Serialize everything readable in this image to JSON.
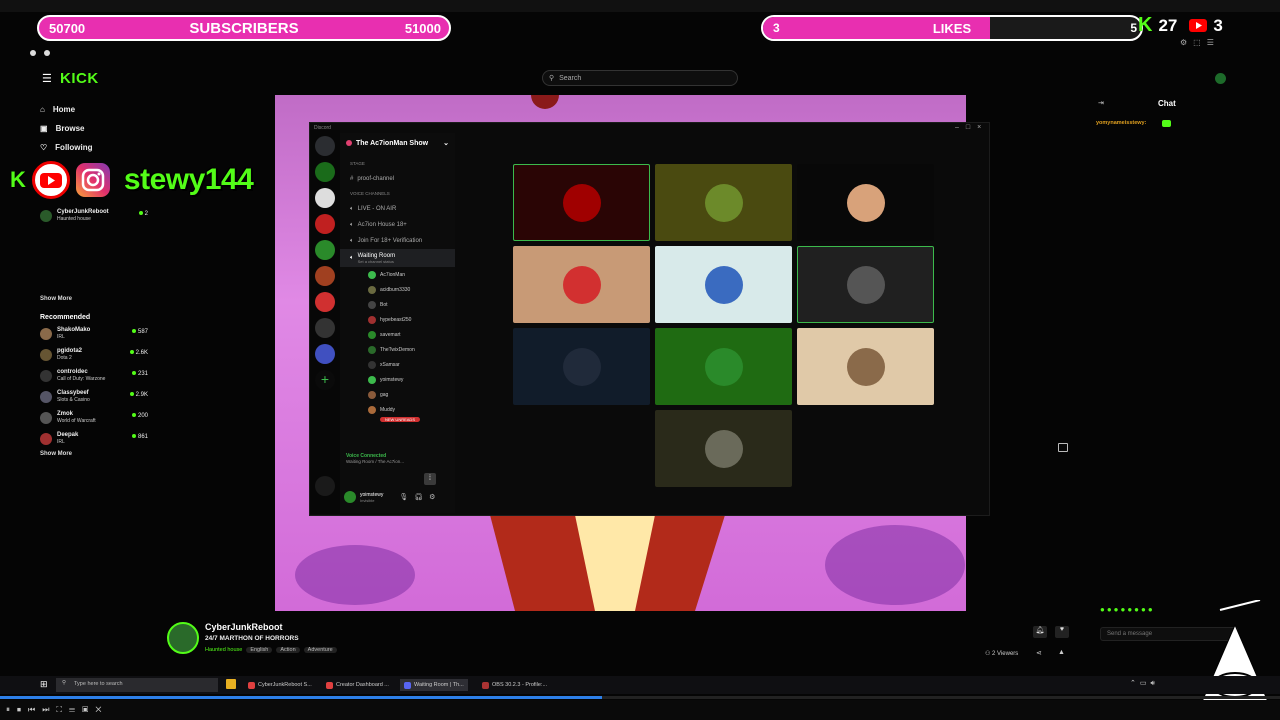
{
  "overlay": {
    "subs_current": "50700",
    "subs_label": "SUBSCRIBERS",
    "subs_goal": "51000",
    "subs_progress": 0.0,
    "likes_current": "3",
    "likes_label": "LIKES",
    "likes_goal": "5",
    "likes_progress": 0.6,
    "kick_count": "27",
    "youtube_count": "3",
    "social_handle": "stewy144",
    "kick_letter": "K",
    "colors": {
      "pill": "#e82fb0",
      "pill_fill": "#ff4fe0",
      "kick_green": "#53fc18",
      "youtube_red": "#ff0000"
    }
  },
  "browser": {
    "search_placeholder": "Search",
    "logo": "KICK"
  },
  "sidebar": {
    "nav": [
      {
        "label": "Home",
        "icon": "home-icon"
      },
      {
        "label": "Browse",
        "icon": "compass-icon"
      },
      {
        "label": "Following",
        "icon": "heart-icon"
      }
    ],
    "following": [
      {
        "name": "CyberJunkReboot",
        "category": "Haunted house",
        "viewers": "2"
      }
    ],
    "show_more": "Show More",
    "recommended_title": "Recommended",
    "recommended": [
      {
        "name": "ShakoMako",
        "category": "IRL",
        "viewers": "587"
      },
      {
        "name": "pgidota2",
        "category": "Dota 2",
        "viewers": "2.6K"
      },
      {
        "name": "controldec",
        "category": "Call of Duty: Warzone",
        "viewers": "231"
      },
      {
        "name": "Classybeef",
        "category": "Slots & Casino",
        "viewers": "2.9K"
      },
      {
        "name": "Zmok",
        "category": "World of Warcraft",
        "viewers": "200"
      },
      {
        "name": "Deepak",
        "category": "IRL",
        "viewers": "861"
      }
    ],
    "show_more_2": "Show More"
  },
  "discord": {
    "app_label": "Discord",
    "server_name": "The Ac7ionMan Show",
    "stage_label": "STAGE",
    "stage_channel": "proof-channel",
    "voice_label": "VOICE CHANNELS",
    "channels": [
      "LIVE - ON AIR",
      "Ac7ion House 18+",
      "Join For 18+ Verification"
    ],
    "active_channel": "Waiting Room",
    "active_channel_status": "Set a channel status",
    "users": [
      "Ac7ionMan",
      "acidburn3330",
      "Bot",
      "hypebeast250",
      "savemart",
      "TheTwixDemon",
      "xSamsar",
      "yoimstewy",
      "gag",
      "Muddy"
    ],
    "new_unreads": "NEW UNREADS",
    "voice_connected": "Voice Connected",
    "voice_connected_sub": "Waiting Room / The Ac7ion...",
    "self_name": "yoimstewy",
    "self_status": "Invisible",
    "tiles": [
      {
        "bg": "#2a0505",
        "face": "#a00000",
        "border": "#3cba4c"
      },
      {
        "bg": "#4a4a10",
        "face": "#6c8a2a",
        "border": "none"
      },
      {
        "bg": "#080808",
        "face": "#d8a27a",
        "border": "none"
      },
      {
        "bg": "#c89a76",
        "face": "#d23030",
        "border": "none"
      },
      {
        "bg": "#d8eaea",
        "face": "#3a6bc0",
        "border": "none"
      },
      {
        "bg": "#202020",
        "face": "#555555",
        "border": "#3cba4c"
      },
      {
        "bg": "#111c2a",
        "face": "#202a3a",
        "border": "none"
      },
      {
        "bg": "#1f6b12",
        "face": "#2a8a2a",
        "border": "none"
      },
      {
        "bg": "#e0c9a8",
        "face": "#8a6a4a",
        "border": "none"
      },
      {
        "bg": "#2a2a1a",
        "face": "#6a6a5a",
        "border": "none"
      }
    ]
  },
  "chat": {
    "title": "Chat",
    "message_user": "yomynameisstewy:",
    "input_placeholder": "Send a message"
  },
  "stream": {
    "channel": "CyberJunkReboot",
    "title": "24/7 MARTHON OF HORRORS",
    "category": "Haunted house",
    "tags": [
      "English",
      "Action",
      "Adventure"
    ],
    "viewers": "2 Viewers"
  },
  "taskbar": {
    "search_placeholder": "Type here to search",
    "items": [
      {
        "label": "CyberJunkReboot S...",
        "color": "#e04040"
      },
      {
        "label": "Creator Dashboard ...",
        "color": "#e04040"
      },
      {
        "label": "Waiting Room | Th...",
        "color": "#5865f2"
      },
      {
        "label": "OBS 30.2.3 - Profile:...",
        "color": "#aa3333"
      }
    ]
  },
  "video": {
    "progress": 0.47
  }
}
